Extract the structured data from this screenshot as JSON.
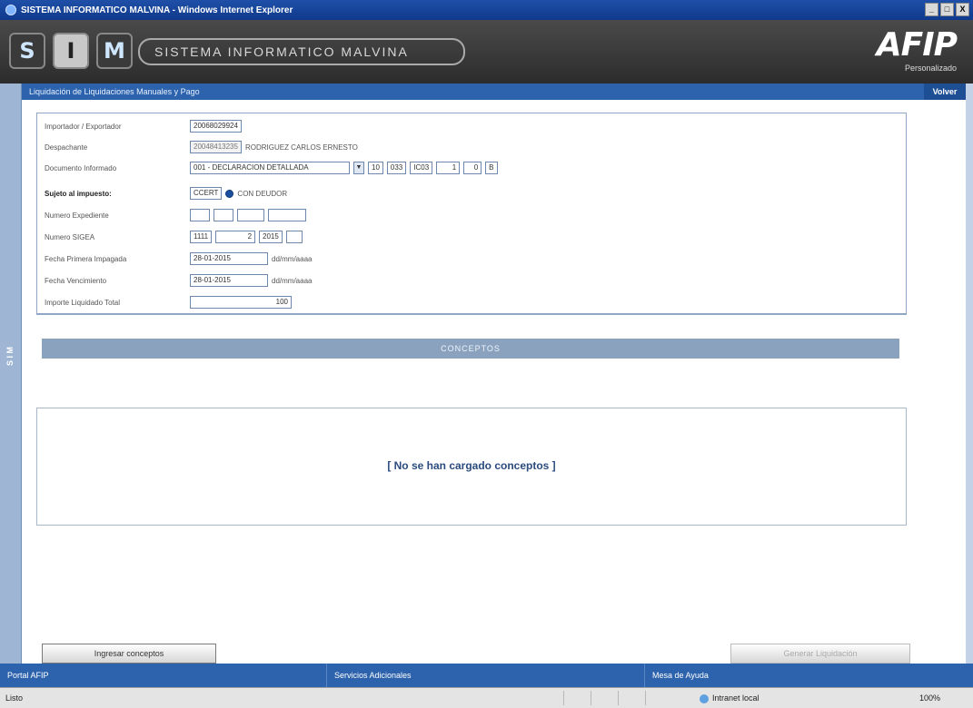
{
  "window": {
    "title": "SISTEMA INFORMATICO MALVINA - Windows Internet Explorer",
    "controls": [
      "_",
      "□",
      "X"
    ]
  },
  "banner": {
    "logo_letters": [
      "S",
      "I",
      "M"
    ],
    "system_name": "SISTEMA INFORMATICO MALVINA",
    "brand": "AFIP",
    "brand_sub": "Personalizado"
  },
  "breadcrumb": {
    "text": "Liquidación de Liquidaciones Manuales y Pago",
    "back_label": "Volver"
  },
  "side_label": "S I M",
  "form": {
    "importador": {
      "label": "Importador / Exportador",
      "value": "20068029924"
    },
    "despachante": {
      "label": "Despachante",
      "value": "20048413235",
      "name": "RODRIGUEZ CARLOS ERNESTO"
    },
    "documento": {
      "label": "Documento Informado",
      "type": "001 - DECLARACION DETALLADA",
      "year": "10",
      "aduana": "033",
      "code": "IC03",
      "number": "1",
      "digit": "0",
      "letter": "B"
    },
    "sujeto": {
      "label": "Sujeto al impuesto:",
      "value": "CCERT",
      "radio_text": "CON DEUDOR"
    },
    "numero_expediente": {
      "label": "Numero Expediente"
    },
    "numero_sigea": {
      "label": "Numero SIGEA",
      "a": "1111",
      "b": "2",
      "c": "2015"
    },
    "fecha_primer_impago": {
      "label": "Fecha Primera Impagada",
      "value": "28-01-2015",
      "hint": "dd/mm/aaaa"
    },
    "fecha_vencimiento": {
      "label": "Fecha Vencimiento",
      "value": "28-01-2015",
      "hint": "dd/mm/aaaa"
    },
    "importe": {
      "label": "Importe Liquidado Total",
      "value": "100"
    }
  },
  "concepts": {
    "header": "CONCEPTOS",
    "empty_message": "[ No se han cargado conceptos ]"
  },
  "buttons": {
    "ingresar": "Ingresar conceptos",
    "generar": "Generar Liquidación"
  },
  "footer": {
    "items": [
      "Portal AFIP",
      "Servicios Adicionales",
      "Mesa de Ayuda"
    ]
  },
  "statusbar": {
    "left": "Listo",
    "zone": "Intranet local",
    "zoom": "100%"
  }
}
